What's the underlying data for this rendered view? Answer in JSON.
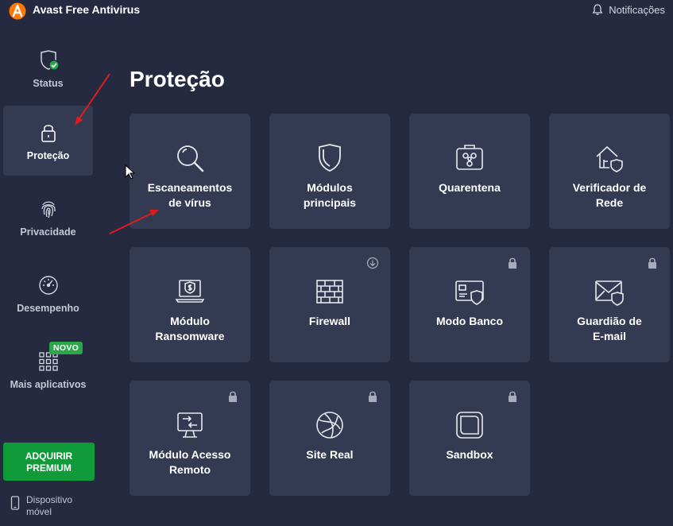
{
  "app": {
    "title": "Avast Free Antivirus",
    "notifications_label": "Notificações",
    "brand_color": "#ff7800"
  },
  "sidebar": {
    "items": [
      {
        "label": "Status",
        "icon": "shield-check-icon",
        "active": false
      },
      {
        "label": "Proteção",
        "icon": "lock-icon",
        "active": true
      },
      {
        "label": "Privacidade",
        "icon": "fingerprint-icon",
        "active": false
      },
      {
        "label": "Desempenho",
        "icon": "speedometer-icon",
        "active": false
      },
      {
        "label": "Mais aplicativos",
        "icon": "apps-grid-icon",
        "active": false,
        "badge": "NOVO"
      }
    ],
    "premium_line1": "ADQUIRIR",
    "premium_line2": "PREMIUM",
    "mobile_line1": "Dispositivo",
    "mobile_line2": "móvel"
  },
  "main": {
    "title": "Proteção",
    "tiles": [
      {
        "line1": "Escaneamentos",
        "line2": "de vírus",
        "icon": "magnifier-icon",
        "corner": ""
      },
      {
        "line1": "Módulos",
        "line2": "principais",
        "icon": "shield-icon",
        "corner": ""
      },
      {
        "line1": "Quarentena",
        "line2": "",
        "icon": "biohazard-box-icon",
        "corner": ""
      },
      {
        "line1": "Verificador de",
        "line2": "Rede",
        "icon": "house-network-shield-icon",
        "corner": ""
      },
      {
        "line1": "Módulo",
        "line2": "Ransomware",
        "icon": "laptop-dollar-shield-icon",
        "corner": ""
      },
      {
        "line1": "Firewall",
        "line2": "",
        "icon": "brick-wall-icon",
        "corner": "download-icon"
      },
      {
        "line1": "Modo Banco",
        "line2": "",
        "icon": "card-shield-icon",
        "corner": "lock-icon"
      },
      {
        "line1": "Guardião de",
        "line2": "E-mail",
        "icon": "envelope-shield-icon",
        "corner": "lock-icon"
      },
      {
        "line1": "Módulo Acesso",
        "line2": "Remoto",
        "icon": "remote-monitor-icon",
        "corner": "lock-icon"
      },
      {
        "line1": "Site Real",
        "line2": "",
        "icon": "globe-icon",
        "corner": "lock-icon"
      },
      {
        "line1": "Sandbox",
        "line2": "",
        "icon": "sandbox-box-icon",
        "corner": "lock-icon"
      }
    ]
  },
  "colors": {
    "background": "#252a41",
    "tile": "#343a52",
    "premium": "#119a3a",
    "badge": "#29a74a",
    "annotation": "#e01b1b"
  }
}
